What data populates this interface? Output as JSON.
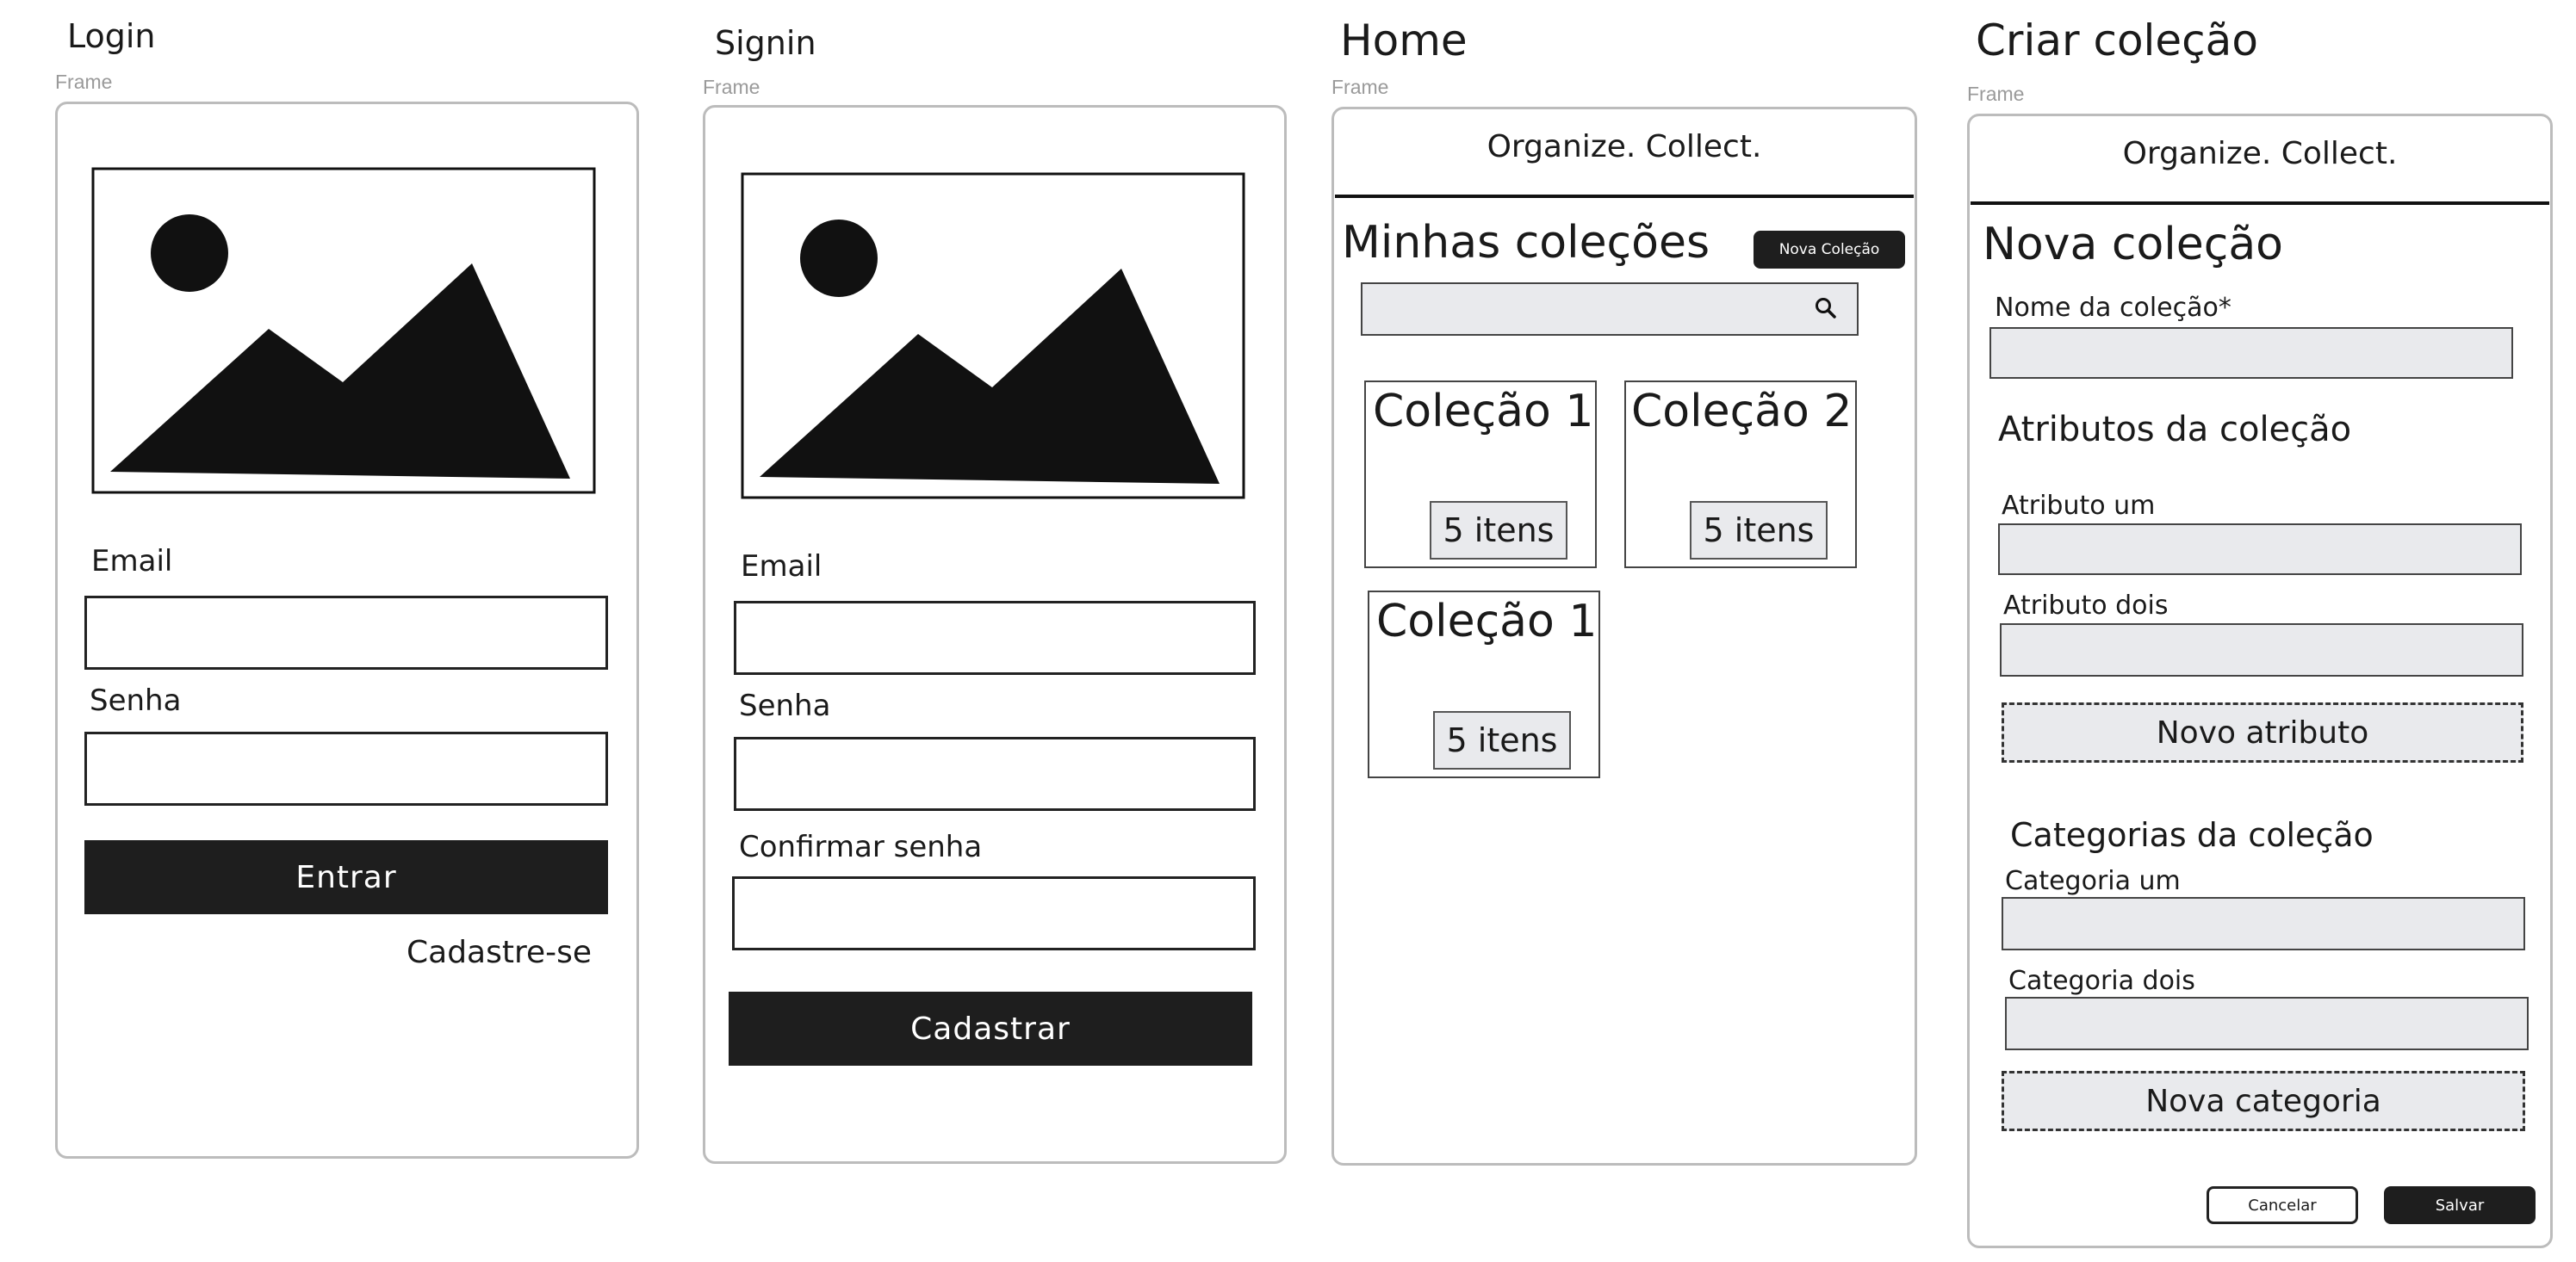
{
  "screens": {
    "login": {
      "title": "Login",
      "frame_label": "Frame",
      "email_label": "Email",
      "password_label": "Senha",
      "submit_label": "Entrar",
      "signup_link": "Cadastre-se"
    },
    "signin": {
      "title": "Signin",
      "frame_label": "Frame",
      "email_label": "Email",
      "password_label": "Senha",
      "confirm_label": "Confirmar senha",
      "submit_label": "Cadastrar"
    },
    "home": {
      "title": "Home",
      "frame_label": "Frame",
      "header": "Organize. Collect.",
      "section_title": "Minhas coleções",
      "new_button": "Nova Coleção",
      "search_icon": "search-icon",
      "cards": [
        {
          "title": "Coleção 1",
          "count": "5 itens"
        },
        {
          "title": "Coleção 2",
          "count": "5 itens"
        },
        {
          "title": "Coleção 1",
          "count": "5 itens"
        }
      ]
    },
    "create": {
      "title": "Criar coleção",
      "frame_label": "Frame",
      "header": "Organize. Collect.",
      "section_title": "Nova coleção",
      "name_label": "Nome da coleção*",
      "attributes_title": "Atributos da coleção",
      "attribute_one": "Atributo um",
      "attribute_two": "Atributo dois",
      "new_attribute": "Novo atributo",
      "categories_title": "Categorias da coleção",
      "category_one": "Categoria um",
      "category_two": "Categoria dois",
      "new_category": "Nova categoria",
      "cancel": "Cancelar",
      "save": "Salvar"
    }
  },
  "colors": {
    "dark": "#1e1e1e",
    "field_gray": "#e9eaed",
    "frame_border": "#bcbcbc",
    "frame_label": "#9a9a9a"
  }
}
